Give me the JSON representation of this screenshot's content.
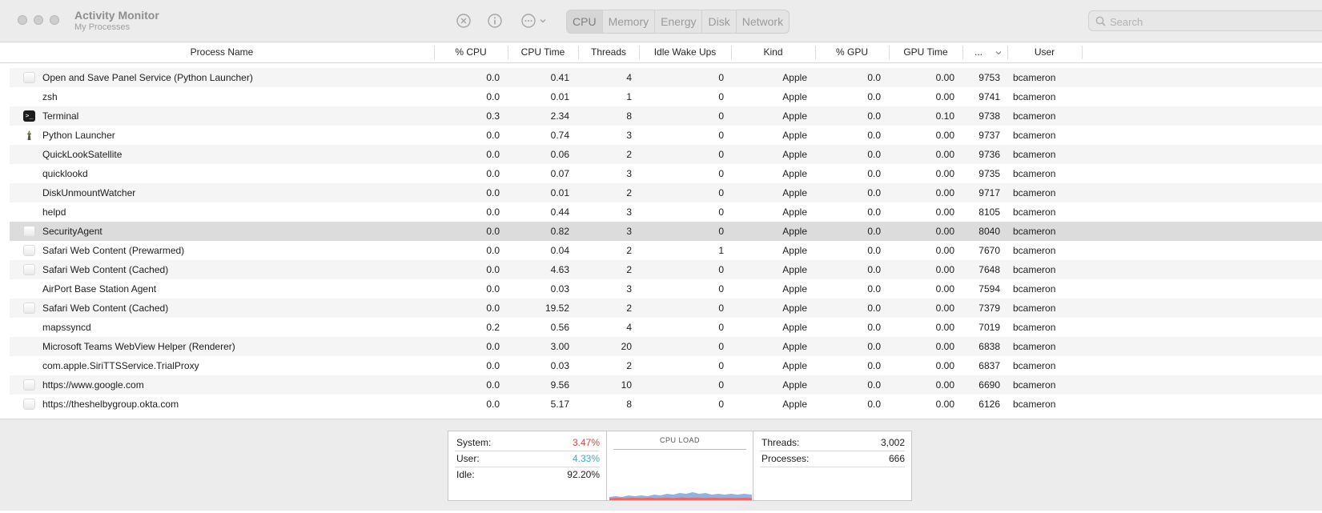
{
  "window": {
    "title": "Activity Monitor",
    "subtitle": "My Processes",
    "tabs": [
      "CPU",
      "Memory",
      "Energy",
      "Disk",
      "Network"
    ],
    "active_tab": "CPU",
    "search": {
      "placeholder": "Search",
      "value": ""
    }
  },
  "table": {
    "columns": [
      "Process Name",
      "% CPU",
      "CPU Time",
      "Threads",
      "Idle Wake Ups",
      "Kind",
      "% GPU",
      "GPU Time",
      "...",
      "User"
    ],
    "rows": [
      {
        "name": "Open and Save Panel Service (Python Launcher)",
        "icon": "blank-app-icon",
        "cpu": "0.0",
        "cpu_time": "0.41",
        "threads": "4",
        "idle_wake_ups": "0",
        "kind": "Apple",
        "gpu": "0.0",
        "gpu_time": "0.00",
        "pid": "9753",
        "user": "bcameron"
      },
      {
        "name": "zsh",
        "icon": "",
        "cpu": "0.0",
        "cpu_time": "0.01",
        "threads": "1",
        "idle_wake_ups": "0",
        "kind": "Apple",
        "gpu": "0.0",
        "gpu_time": "0.00",
        "pid": "9741",
        "user": "bcameron"
      },
      {
        "name": "Terminal",
        "icon": "terminal-icon",
        "cpu": "0.3",
        "cpu_time": "2.34",
        "threads": "8",
        "idle_wake_ups": "0",
        "kind": "Apple",
        "gpu": "0.0",
        "gpu_time": "0.10",
        "pid": "9738",
        "user": "bcameron"
      },
      {
        "name": "Python Launcher",
        "icon": "python-launcher-icon",
        "cpu": "0.0",
        "cpu_time": "0.74",
        "threads": "3",
        "idle_wake_ups": "0",
        "kind": "Apple",
        "gpu": "0.0",
        "gpu_time": "0.00",
        "pid": "9737",
        "user": "bcameron"
      },
      {
        "name": "QuickLookSatellite",
        "icon": "",
        "cpu": "0.0",
        "cpu_time": "0.06",
        "threads": "2",
        "idle_wake_ups": "0",
        "kind": "Apple",
        "gpu": "0.0",
        "gpu_time": "0.00",
        "pid": "9736",
        "user": "bcameron"
      },
      {
        "name": "quicklookd",
        "icon": "",
        "cpu": "0.0",
        "cpu_time": "0.07",
        "threads": "3",
        "idle_wake_ups": "0",
        "kind": "Apple",
        "gpu": "0.0",
        "gpu_time": "0.00",
        "pid": "9735",
        "user": "bcameron"
      },
      {
        "name": "DiskUnmountWatcher",
        "icon": "",
        "cpu": "0.0",
        "cpu_time": "0.01",
        "threads": "2",
        "idle_wake_ups": "0",
        "kind": "Apple",
        "gpu": "0.0",
        "gpu_time": "0.00",
        "pid": "9717",
        "user": "bcameron"
      },
      {
        "name": "helpd",
        "icon": "",
        "cpu": "0.0",
        "cpu_time": "0.44",
        "threads": "3",
        "idle_wake_ups": "0",
        "kind": "Apple",
        "gpu": "0.0",
        "gpu_time": "0.00",
        "pid": "8105",
        "user": "bcameron"
      },
      {
        "name": "SecurityAgent",
        "icon": "security-agent-icon",
        "cpu": "0.0",
        "cpu_time": "0.82",
        "threads": "3",
        "idle_wake_ups": "0",
        "kind": "Apple",
        "gpu": "0.0",
        "gpu_time": "0.00",
        "pid": "8040",
        "user": "bcameron",
        "selected": true
      },
      {
        "name": "Safari Web Content (Prewarmed)",
        "icon": "blank-app-icon",
        "cpu": "0.0",
        "cpu_time": "0.04",
        "threads": "2",
        "idle_wake_ups": "1",
        "kind": "Apple",
        "gpu": "0.0",
        "gpu_time": "0.00",
        "pid": "7670",
        "user": "bcameron"
      },
      {
        "name": "Safari Web Content (Cached)",
        "icon": "blank-app-icon",
        "cpu": "0.0",
        "cpu_time": "4.63",
        "threads": "2",
        "idle_wake_ups": "0",
        "kind": "Apple",
        "gpu": "0.0",
        "gpu_time": "0.00",
        "pid": "7648",
        "user": "bcameron"
      },
      {
        "name": "AirPort Base Station Agent",
        "icon": "",
        "cpu": "0.0",
        "cpu_time": "0.03",
        "threads": "3",
        "idle_wake_ups": "0",
        "kind": "Apple",
        "gpu": "0.0",
        "gpu_time": "0.00",
        "pid": "7594",
        "user": "bcameron"
      },
      {
        "name": "Safari Web Content (Cached)",
        "icon": "blank-app-icon",
        "cpu": "0.0",
        "cpu_time": "19.52",
        "threads": "2",
        "idle_wake_ups": "0",
        "kind": "Apple",
        "gpu": "0.0",
        "gpu_time": "0.00",
        "pid": "7379",
        "user": "bcameron"
      },
      {
        "name": "mapssyncd",
        "icon": "",
        "cpu": "0.2",
        "cpu_time": "0.56",
        "threads": "4",
        "idle_wake_ups": "0",
        "kind": "Apple",
        "gpu": "0.0",
        "gpu_time": "0.00",
        "pid": "7019",
        "user": "bcameron"
      },
      {
        "name": "Microsoft Teams WebView Helper (Renderer)",
        "icon": "",
        "cpu": "0.0",
        "cpu_time": "3.00",
        "threads": "20",
        "idle_wake_ups": "0",
        "kind": "Apple",
        "gpu": "0.0",
        "gpu_time": "0.00",
        "pid": "6838",
        "user": "bcameron"
      },
      {
        "name": "com.apple.SiriTTSService.TrialProxy",
        "icon": "",
        "cpu": "0.0",
        "cpu_time": "0.03",
        "threads": "2",
        "idle_wake_ups": "0",
        "kind": "Apple",
        "gpu": "0.0",
        "gpu_time": "0.00",
        "pid": "6837",
        "user": "bcameron"
      },
      {
        "name": "https://www.google.com",
        "icon": "blank-app-icon",
        "cpu": "0.0",
        "cpu_time": "9.56",
        "threads": "10",
        "idle_wake_ups": "0",
        "kind": "Apple",
        "gpu": "0.0",
        "gpu_time": "0.00",
        "pid": "6690",
        "user": "bcameron"
      },
      {
        "name": "https://theshelbygroup.okta.com",
        "icon": "blank-app-icon",
        "cpu": "0.0",
        "cpu_time": "5.17",
        "threads": "8",
        "idle_wake_ups": "0",
        "kind": "Apple",
        "gpu": "0.0",
        "gpu_time": "0.00",
        "pid": "6126",
        "user": "bcameron"
      }
    ]
  },
  "footer": {
    "system_label": "System:",
    "system_value": "3.47%",
    "user_label": "User:",
    "user_value": "4.33%",
    "idle_label": "Idle:",
    "idle_value": "92.20%",
    "cpu_load_title": "CPU LOAD",
    "threads_label": "Threads:",
    "threads_value": "3,002",
    "processes_label": "Processes:",
    "processes_value": "666"
  },
  "colors": {
    "system": "#e0443e",
    "user": "#3ea7e0",
    "cpu_user_fill": "#8db4e2",
    "cpu_system_fill": "#e86b6b"
  }
}
